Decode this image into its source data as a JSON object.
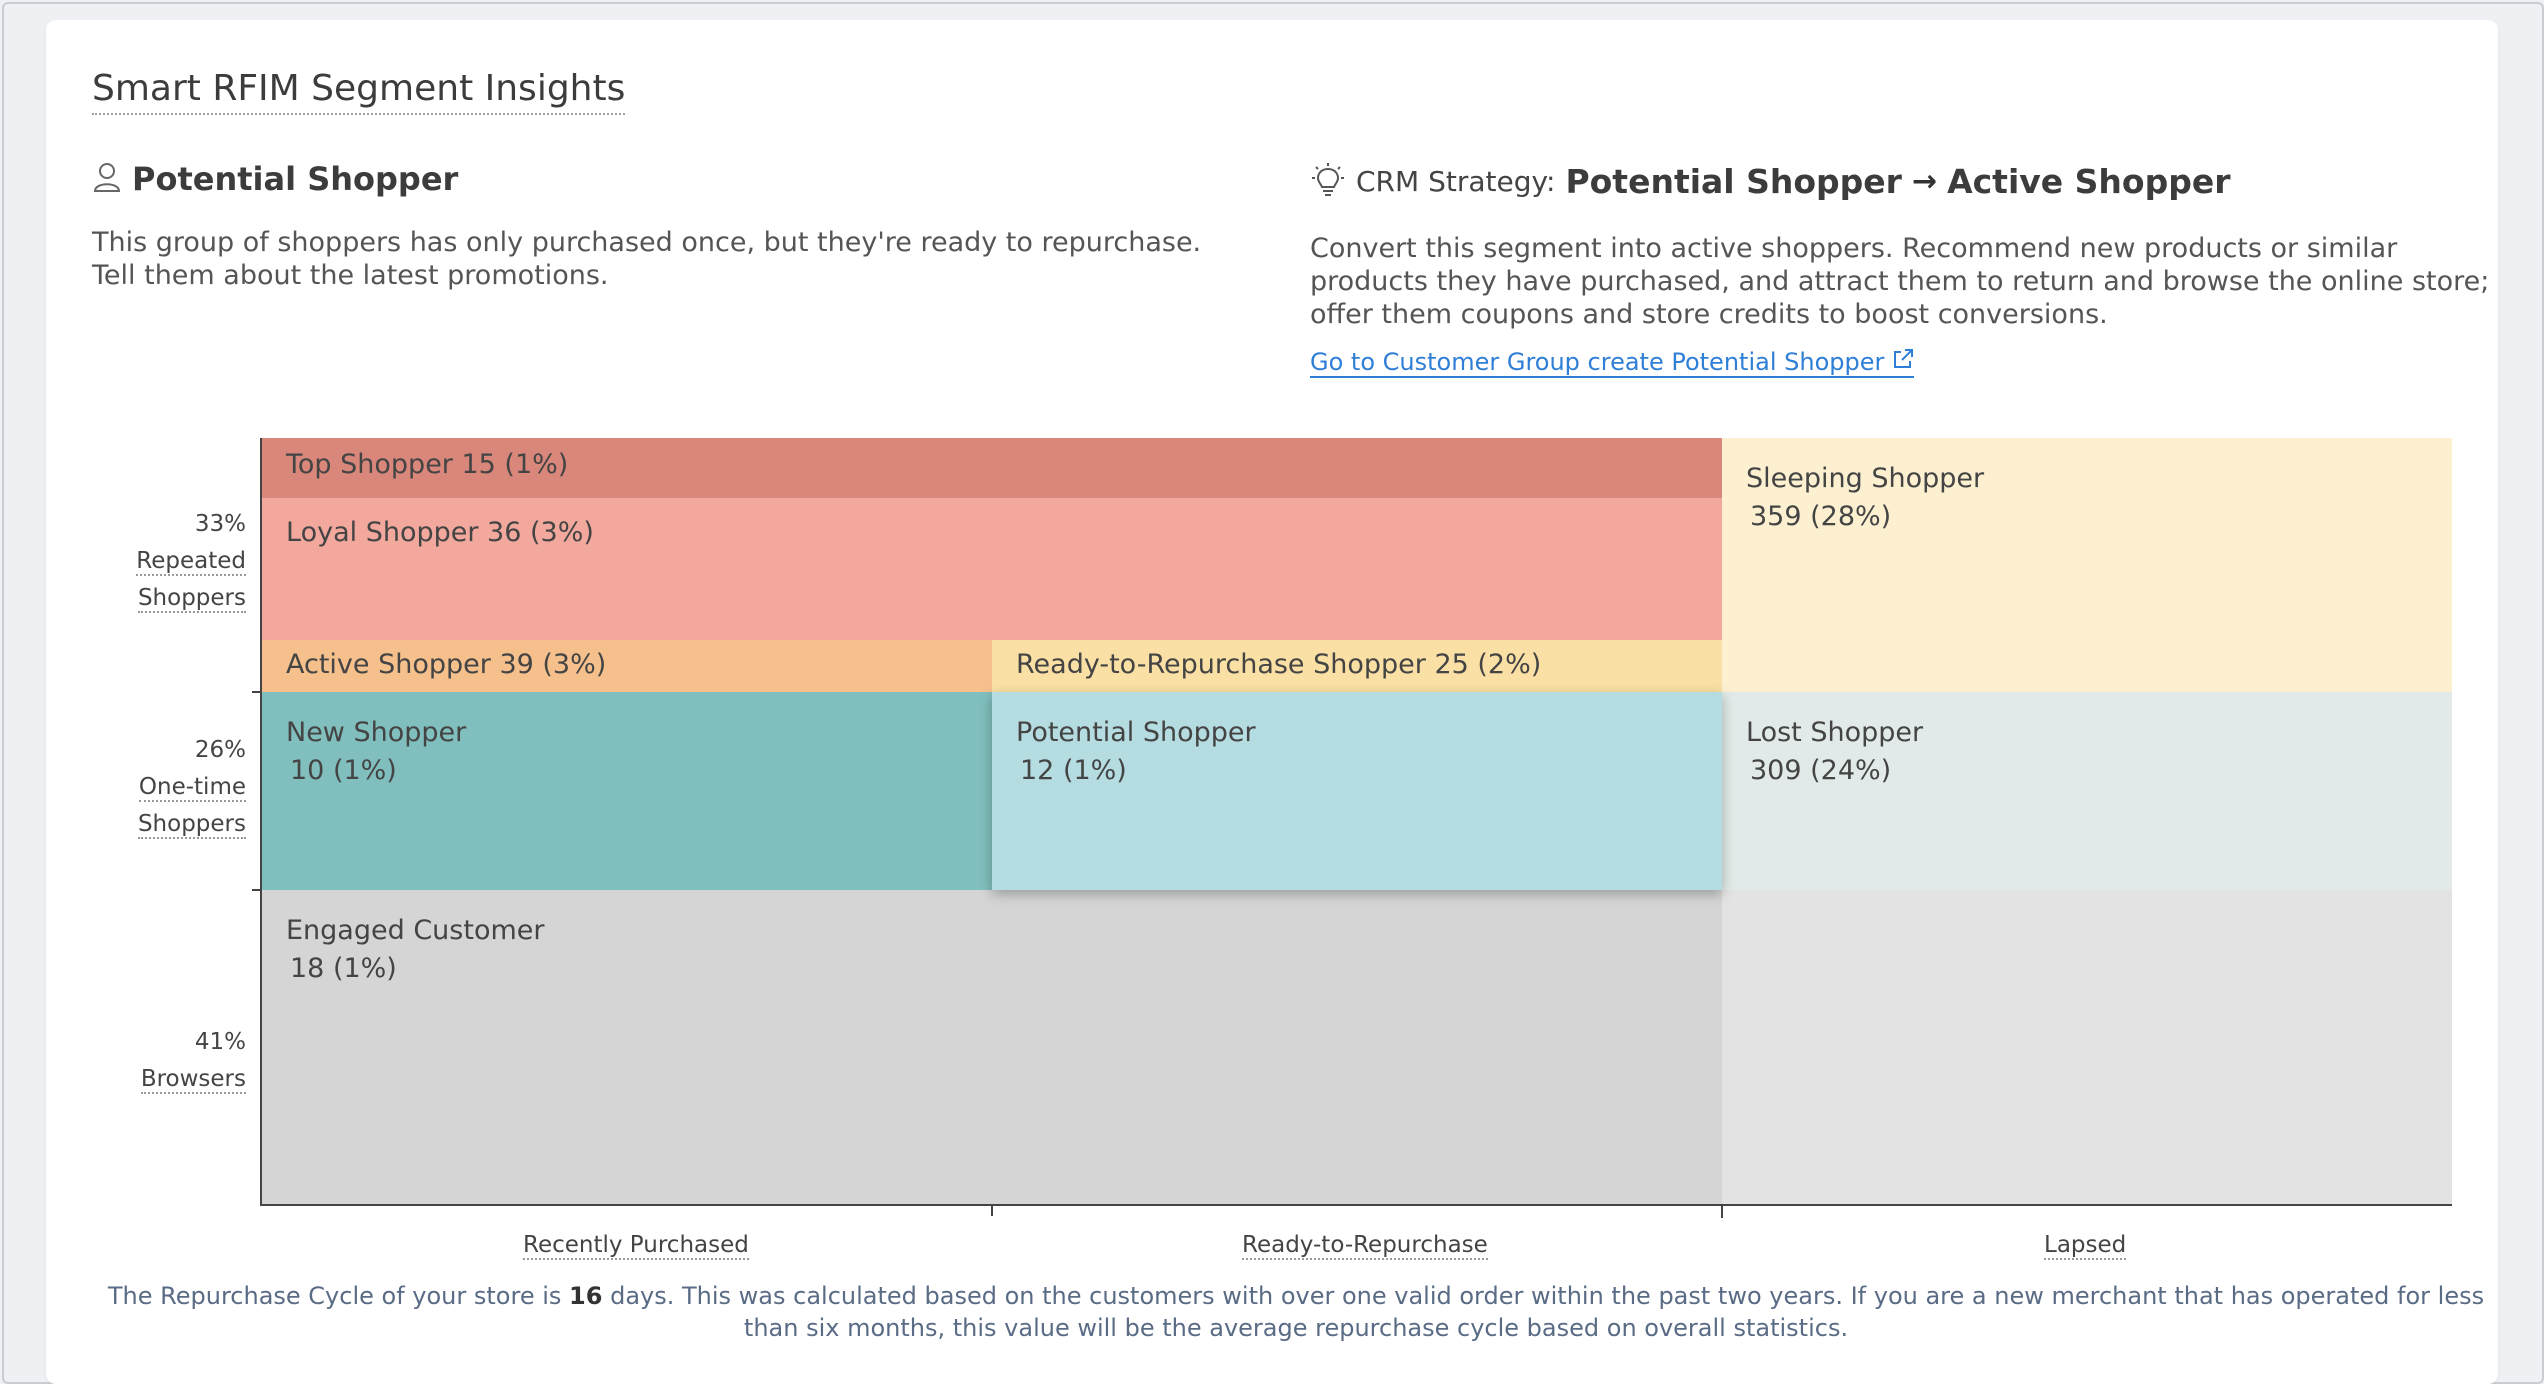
{
  "card": {
    "title": "Smart RFIM Segment Insights"
  },
  "segment": {
    "icon": "user-icon",
    "name": "Potential Shopper",
    "description": "This group of shoppers has only purchased once, but they're ready to repurchase. Tell them about the latest promotions."
  },
  "crm": {
    "icon": "lightbulb-icon",
    "label": "CRM Strategy:",
    "from": "Potential Shopper",
    "arrow": "→",
    "to": "Active Shopper",
    "description": "Convert this segment into active shoppers. Recommend new products or similar products they have purchased, and attract them to return and browse the online store; offer them coupons and store credits to boost conversions.",
    "link_text": "Go to Customer Group create Potential Shopper",
    "link_icon": "external-link-icon"
  },
  "y_axis": [
    {
      "percent": "33%",
      "label_line1": "Repeated",
      "label_line2": "Shoppers"
    },
    {
      "percent": "26%",
      "label_line1": "One-time",
      "label_line2": "Shoppers"
    },
    {
      "percent": "41%",
      "label": "Browsers"
    }
  ],
  "x_axis": [
    "Recently Purchased",
    "Ready-to-Repurchase",
    "Lapsed"
  ],
  "segments": {
    "top": {
      "label": "Top Shopper 15 (1%)",
      "color": "#d9877a"
    },
    "loyal": {
      "label": "Loyal Shopper 36 (3%)",
      "color": "#f2a89c"
    },
    "active": {
      "label": "Active Shopper 39 (3%)",
      "color": "#f5c08c"
    },
    "ready": {
      "label": "Ready-to-Repurchase Shopper 25 (2%)",
      "color": "#fae0a4"
    },
    "sleeping": {
      "name": "Sleeping Shopper",
      "count": "359 (28%)",
      "color": "#fcf0d0"
    },
    "new": {
      "name": "New Shopper",
      "count": "10 (1%)",
      "color": "#80bfbd"
    },
    "potential": {
      "name": "Potential Shopper",
      "count": "12 (1%)",
      "color": "#b4dce1"
    },
    "lost": {
      "name": "Lost Shopper",
      "count": "309 (24%)",
      "color": "#e1eae8"
    },
    "engaged": {
      "name": "Engaged Customer",
      "count": "18 (1%)",
      "color": "#d5d5d5"
    },
    "lapsed_browsers": {
      "color": "#e3e3e3"
    }
  },
  "footnote": {
    "prefix": "The Repurchase Cycle of your store is",
    "days": "16",
    "suffix": "days. This was calculated based on the customers with over one valid order within the past two years. If you are a new merchant that has operated for less than six months, this value will be the average repurchase cycle based on overall statistics."
  }
}
